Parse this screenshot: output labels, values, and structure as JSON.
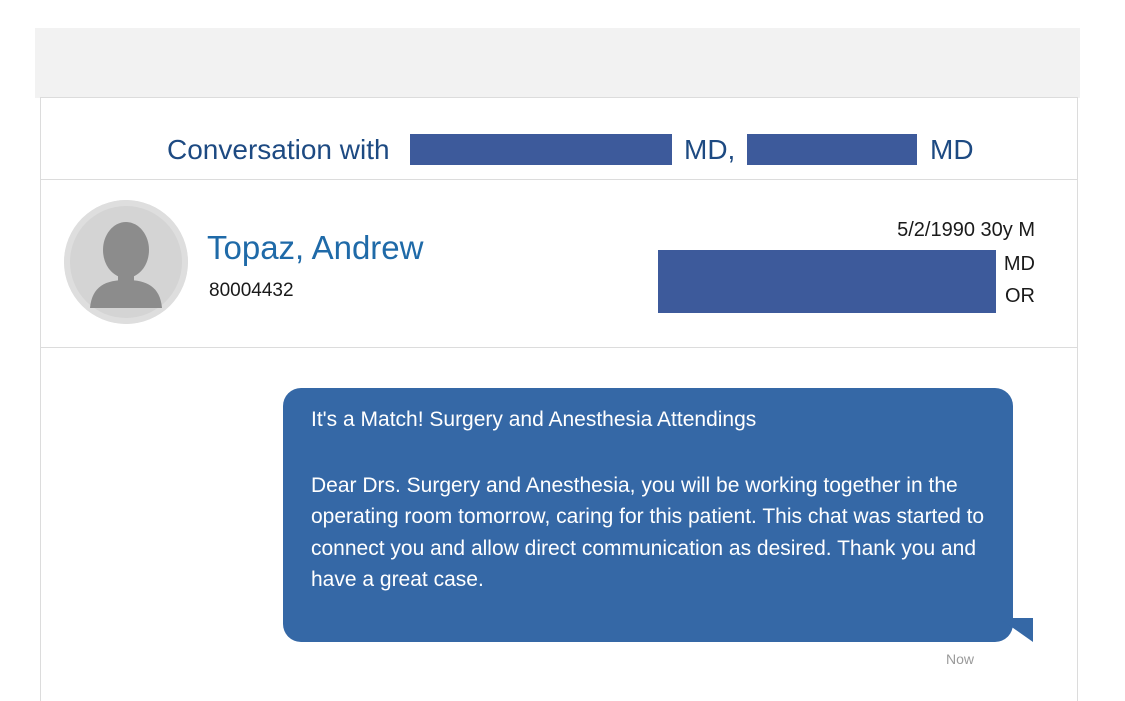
{
  "conversation": {
    "title_prefix": "Conversation with",
    "participant1_suffix": "MD,",
    "participant2_suffix": "MD"
  },
  "patient": {
    "name": "Topaz, Andrew",
    "mrn": "80004432",
    "dob_age_sex": "5/2/1990 30y M",
    "provider_suffix": "MD",
    "location": "OR"
  },
  "message": {
    "subject": "It's a Match! Surgery and Anesthesia Attendings",
    "body": "Dear Drs. Surgery and Anesthesia, you will be working together in the operating room tomorrow, caring for this patient. This chat was started to connect you and allow direct communication as desired. Thank you and have a great case.",
    "timestamp": "Now"
  },
  "colors": {
    "title": "#1d4a82",
    "name": "#1f6aa8",
    "bubble": "#3568a6",
    "redaction": "#3d5a9b"
  }
}
